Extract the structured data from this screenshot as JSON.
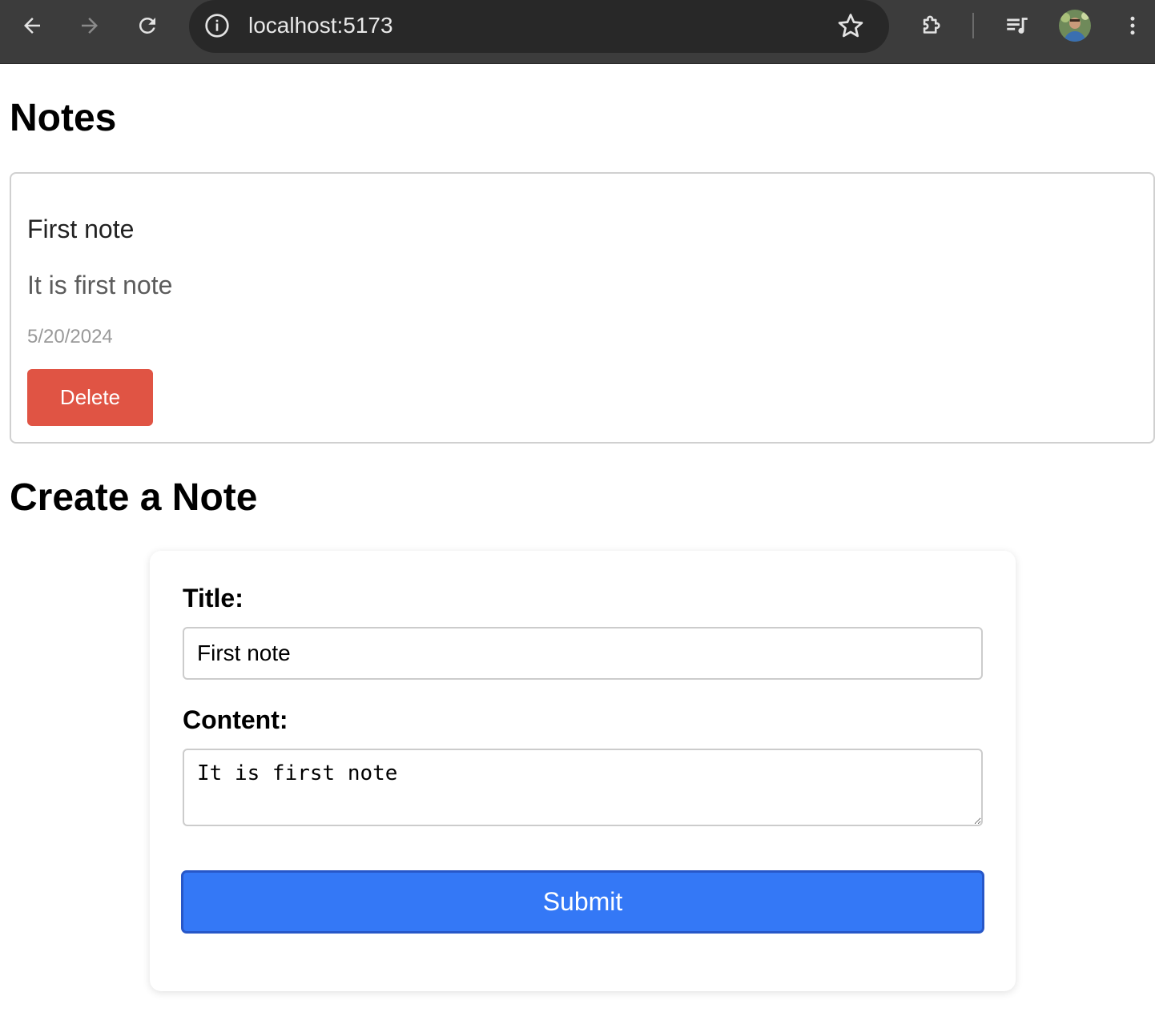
{
  "browser": {
    "url": "localhost:5173",
    "icons": {
      "back": "arrow-left-icon",
      "forward": "arrow-right-icon",
      "reload": "reload-icon",
      "site_info": "info-icon",
      "bookmark": "star-icon",
      "extensions": "puzzle-icon",
      "media": "media-queue-icon",
      "menu": "kebab-menu-icon"
    },
    "colors": {
      "toolbar": "#3c3c3c",
      "omnibox": "#282828"
    }
  },
  "page": {
    "heading": "Notes",
    "notes": [
      {
        "title": "First note",
        "content": "It is first note",
        "date": "5/20/2024",
        "delete_label": "Delete"
      }
    ],
    "create": {
      "heading": "Create a Note",
      "title_label": "Title:",
      "title_value": "First note",
      "content_label": "Content:",
      "content_value": "It is first note",
      "submit_label": "Submit"
    }
  },
  "colors": {
    "delete_button": "#e05444",
    "submit_button": "#3478f6",
    "submit_border": "#2757c8"
  }
}
